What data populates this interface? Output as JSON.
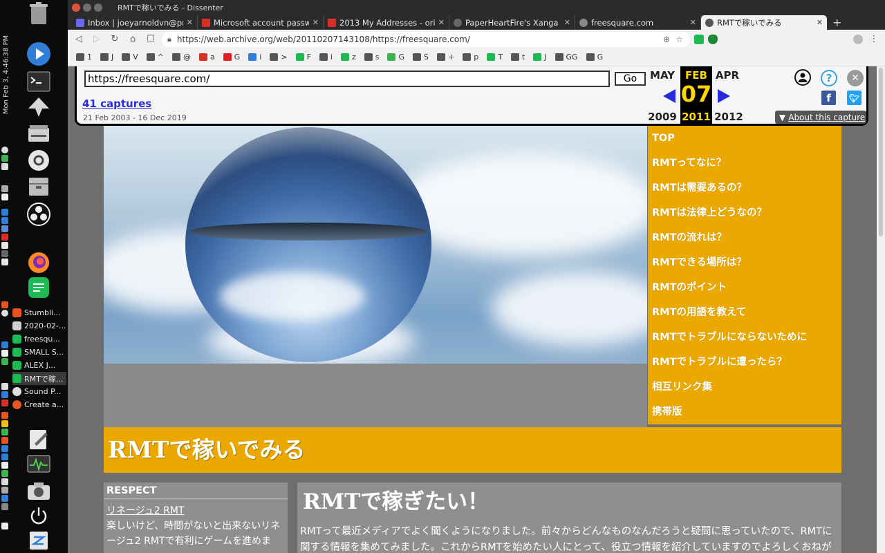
{
  "os": {
    "clock": "Mon Feb  3,  4:46:38 PM",
    "tasks": [
      {
        "label": "Stumbli...",
        "color": "#e8541f"
      },
      {
        "label": "2020-02-...",
        "color": "#cfcfcf"
      },
      {
        "label": "freesqu...",
        "color": "#1db954"
      },
      {
        "label": "SMALL S...",
        "color": "#1db954"
      },
      {
        "label": "ALEX J...",
        "color": "#1db954"
      },
      {
        "label": "RMTで稼...",
        "color": "#1db954"
      },
      {
        "label": "Sound P...",
        "color": "#e0e0e0"
      },
      {
        "label": "Create a...",
        "color": "#e8541f"
      }
    ]
  },
  "browser": {
    "window_title": "RMTで稼いでみる - Dissenter",
    "tabs": [
      {
        "label": "Inbox | joeyarnoldvn@pro",
        "color": "#6a6af0",
        "active": false
      },
      {
        "label": "Microsoft account passwo",
        "color": "#d93025",
        "active": false
      },
      {
        "label": "2013 My Addresses - origin",
        "color": "#d93025",
        "active": false
      },
      {
        "label": "PaperHeartFire's Xanga Sl",
        "color": "#666666",
        "active": false
      },
      {
        "label": "freesquare.com",
        "color": "#888888",
        "active": false
      },
      {
        "label": "RMTで稼いでみる",
        "color": "#555555",
        "active": true
      }
    ],
    "new_tab": "+",
    "url": "https://web.archive.org/web/20110207143108/https://freesquare.com/",
    "bookmarks": [
      "1",
      "J",
      "V",
      "^",
      "@",
      "a",
      "G",
      "i",
      ">",
      "F",
      "i",
      "z",
      "s",
      "G",
      "S",
      "+",
      "p",
      "T",
      "t",
      "J",
      "GG",
      "G"
    ]
  },
  "wayback": {
    "url_value": "https://freesquare.com/",
    "go_label": "Go",
    "captures": "41 captures",
    "range": "21 Feb 2003 - 16 Dec 2019",
    "prev_month": "MAY",
    "cur_month": "FEB",
    "next_month": "APR",
    "cur_day": "07",
    "prev_year": "2009",
    "cur_year": "2011",
    "next_year": "2012",
    "about": "About this capture",
    "colors": {
      "link": "#2a2adf",
      "highlight": "#ffd700"
    }
  },
  "site": {
    "nav": [
      "TOP",
      "RMTってなに？",
      "RMTは需要あるの？",
      "RMTは法律上どうなの？",
      "RMTの流れは？",
      "RMTできる場所は？",
      "RMTのポイント",
      "RMTの用語を教えて",
      "RMTでトラブルにならないために",
      "RMTでトラブルに遭ったら？",
      "相互リンク集",
      "携帯版"
    ],
    "title": "RMTで稼いでみる",
    "respect_title": "RESPECT",
    "respect_link": "リネージュ2 RMT",
    "respect_text": "楽しいけど、時間がないと出来ないリネージュ2 RMTで有利にゲームを進めま",
    "main_title": "RMTで稼ぎたい！",
    "main_text": "RMTって最近メディアでよく聞くようになりました。前々からどんなものなんだろうと疑問に思っていたので、RMTに関する情報を集めてみました。これからRMTを始めたい人にとって、役立つ情報を紹介していますのでよろしくおねがいしま",
    "colors": {
      "accent": "#eaa800",
      "panel": "#8f8f8f"
    }
  }
}
